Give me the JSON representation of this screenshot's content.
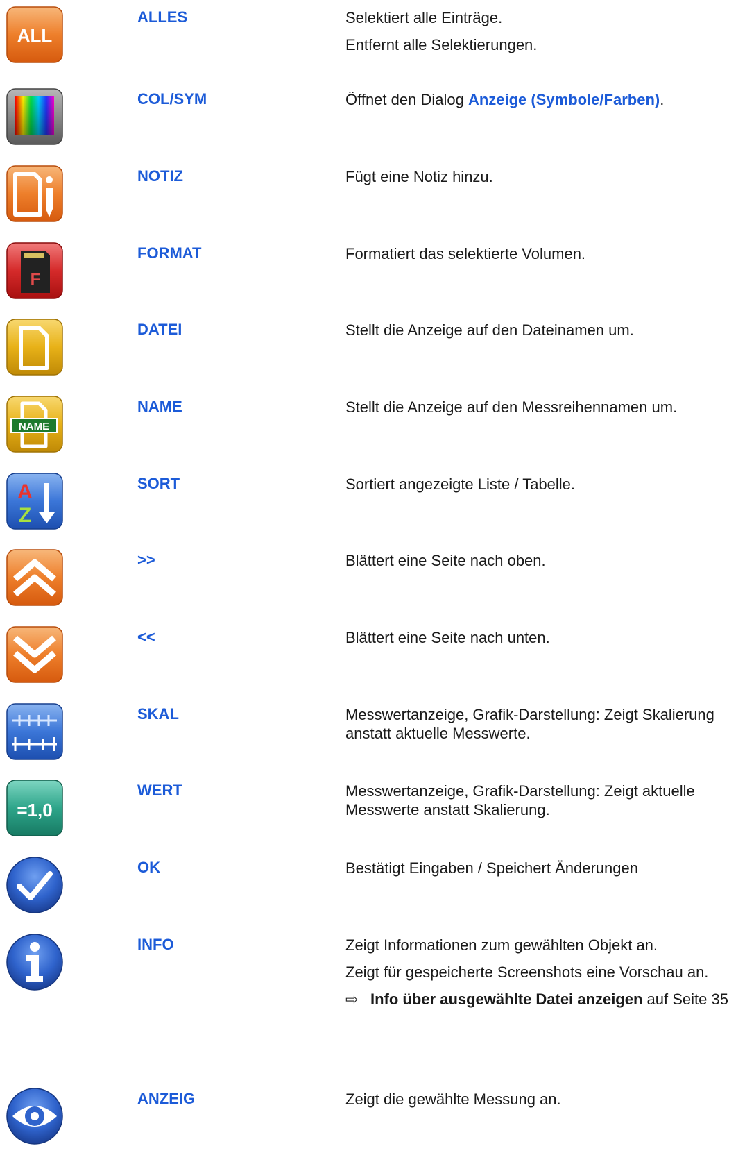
{
  "rows": [
    {
      "icon": "all-icon",
      "label": "ALLES",
      "desc": [
        "Selektiert alle Einträge.",
        "Entfernt alle Selektierungen."
      ]
    },
    {
      "icon": "color-spectrum-icon",
      "label": "COL/SYM",
      "desc_prefix": "Öffnet den Dialog ",
      "desc_link": "Anzeige (Symbole/Farben)",
      "desc_suffix": "."
    },
    {
      "icon": "note-pencil-icon",
      "label": "NOTIZ",
      "desc": [
        "Fügt eine Notiz hinzu."
      ]
    },
    {
      "icon": "sd-card-format-icon",
      "label": "FORMAT",
      "desc": [
        "Formatiert das selektierte Volumen."
      ]
    },
    {
      "icon": "file-icon",
      "label": "DATEI",
      "desc": [
        "Stellt die Anzeige auf den Dateinamen um."
      ]
    },
    {
      "icon": "file-name-icon",
      "label": "NAME",
      "desc": [
        "Stellt die Anzeige auf den Messreihennamen um."
      ],
      "icon_text": "NAME"
    },
    {
      "icon": "sort-az-icon",
      "label": "SORT",
      "desc": [
        "Sortiert angezeigte Liste / Tabelle."
      ],
      "icon_text_a": "A",
      "icon_text_z": "Z"
    },
    {
      "icon": "page-up-icon",
      "label": ">>",
      "desc": [
        "Blättert eine Seite nach oben."
      ]
    },
    {
      "icon": "page-down-icon",
      "label": "<<",
      "desc": [
        "Blättert eine Seite nach unten."
      ]
    },
    {
      "icon": "scale-ruler-icon",
      "label": "SKAL",
      "desc": [
        "Messwertanzeige, Grafik-Darstellung: Zeigt Skalierung anstatt aktuelle Messwerte."
      ]
    },
    {
      "icon": "value-icon",
      "label": "WERT",
      "desc": [
        "Messwertanzeige, Grafik-Darstellung: Zeigt aktuelle Messwerte anstatt Skalierung."
      ],
      "icon_text": "=1,0"
    },
    {
      "icon": "checkmark-icon",
      "label": "OK",
      "desc": [
        "Bestätigt Eingaben / Speichert Änderungen"
      ]
    },
    {
      "icon": "info-icon",
      "label": "INFO",
      "desc": [
        "Zeigt Informationen zum gewählten Objekt an.",
        "Zeigt für gespeicherte Screenshots eine Vorschau an."
      ],
      "xref_arrow": "⇨",
      "xref_title": "Info über ausgewählte Datei anzeigen",
      "xref_suffix": " auf Seite 35"
    },
    {
      "icon": "eye-icon",
      "label": "ANZEIG",
      "desc": [
        "Zeigt die gewählte Messung an."
      ]
    }
  ],
  "icon_labels": {
    "all": "ALL",
    "format": "F"
  }
}
